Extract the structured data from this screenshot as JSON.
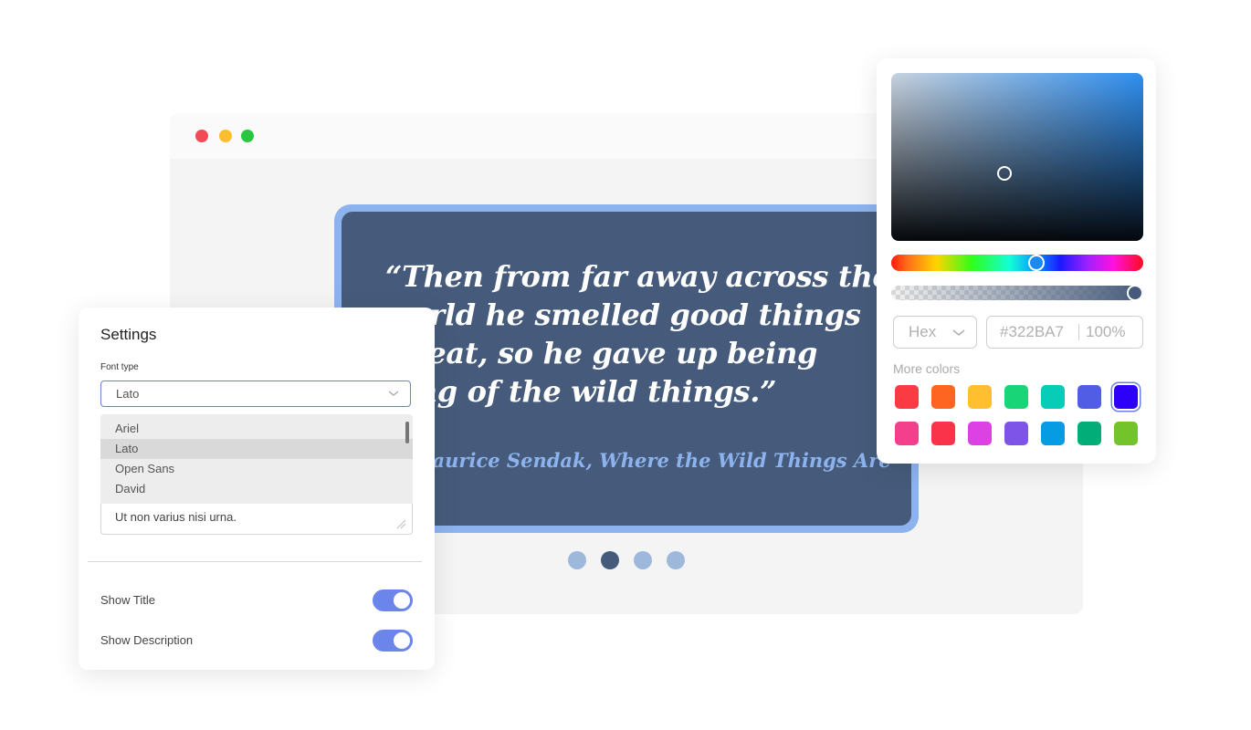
{
  "browser": {
    "traffic_lights": [
      "close",
      "minimize",
      "maximize"
    ]
  },
  "quote": {
    "text": "“Then from far away across the world he smelled good things to eat, so he gave up being king of the wild things.”",
    "author": "— Maurice Sendak, Where the Wild Things Are",
    "slides": 4,
    "active_slide": 2
  },
  "settings": {
    "title": "Settings",
    "font_label": "Font type",
    "font_selected": "Lato",
    "font_options": [
      "Ariel",
      "Lato",
      "Open Sans",
      "David"
    ],
    "description_value": "Ut non varius nisi urna.",
    "toggles": [
      {
        "label": "Show Title",
        "on": true
      },
      {
        "label": "Show Description",
        "on": true
      }
    ]
  },
  "color_picker": {
    "mode": "Hex",
    "hex_value": "#322BA7",
    "alpha": "100%",
    "hue_position": 0.575,
    "alpha_position": 1.0,
    "saturation": 0.45,
    "brightness": 0.4,
    "more_colors_label": "More colors",
    "swatches": [
      "#fb3b44",
      "#fe6521",
      "#ffbf2e",
      "#18d578",
      "#07ccb7",
      "#525de6",
      "#2d00fa",
      "#f43f8c",
      "#fa334a",
      "#db41e3",
      "#7d53e8",
      "#069ce3",
      "#02ad78",
      "#73c42a"
    ],
    "selected_swatch": 6
  },
  "colors": {
    "accent": "#6b85ea",
    "card_bg": "#465b7b",
    "card_border": "#8db3ee"
  }
}
